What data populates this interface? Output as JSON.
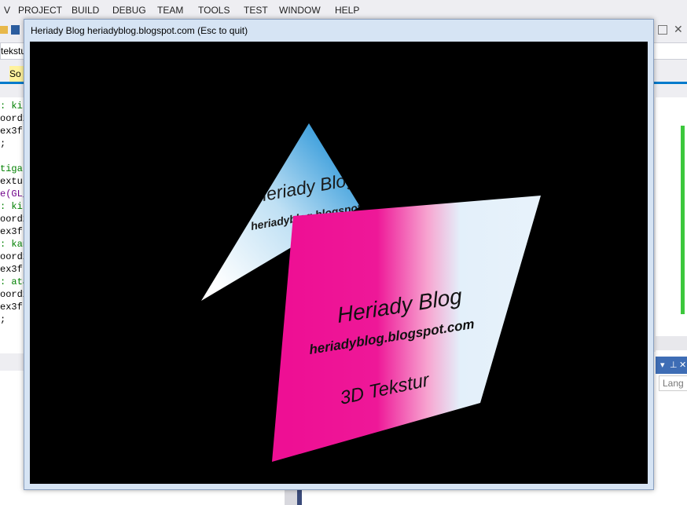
{
  "menu": [
    "V",
    "PROJECT",
    "BUILD",
    "DEBUG",
    "TEAM",
    "TOOLS",
    "TEST",
    "WINDOW",
    "HELP"
  ],
  "combo_text": "tekstur",
  "doc_tab_text": "So",
  "code_lines": [
    {
      "text": ": kir",
      "color": "green"
    },
    {
      "text": "oord2",
      "color": "black"
    },
    {
      "text": "ex3f(",
      "color": "black"
    },
    {
      "text": ";",
      "color": "black"
    },
    {
      "text": "",
      "color": "black"
    },
    {
      "text": "tiga",
      "color": "green"
    },
    {
      "text": "extu",
      "color": "black"
    },
    {
      "text": "e(GL_",
      "color": "purple"
    },
    {
      "text": ": kir",
      "color": "green"
    },
    {
      "text": "oord2",
      "color": "black"
    },
    {
      "text": "ex3f(",
      "color": "black"
    },
    {
      "text": ": kan",
      "color": "green"
    },
    {
      "text": "oord2",
      "color": "black"
    },
    {
      "text": "ex3f(",
      "color": "black"
    },
    {
      "text": ": ata",
      "color": "green"
    },
    {
      "text": "oord2",
      "color": "black"
    },
    {
      "text": "ex3f(",
      "color": "black"
    },
    {
      "text": ";",
      "color": "black"
    }
  ],
  "lang_label": "Lang",
  "gl_window": {
    "title": "Heriady Blog heriadyblog.blogspot.com (Esc to quit)"
  },
  "triangle_texture": {
    "title": "Heriady Blog",
    "url": "heriadyblog.blogspot.com"
  },
  "quad_texture": {
    "title": "Heriady Blog",
    "url": "heriadyblog.blogspot.com",
    "caption": "3D Tekstur"
  },
  "colors": {
    "pink": "#f0189a",
    "pale_blue": "#e6f2fb",
    "sky_blue": "#4aa6e0"
  }
}
